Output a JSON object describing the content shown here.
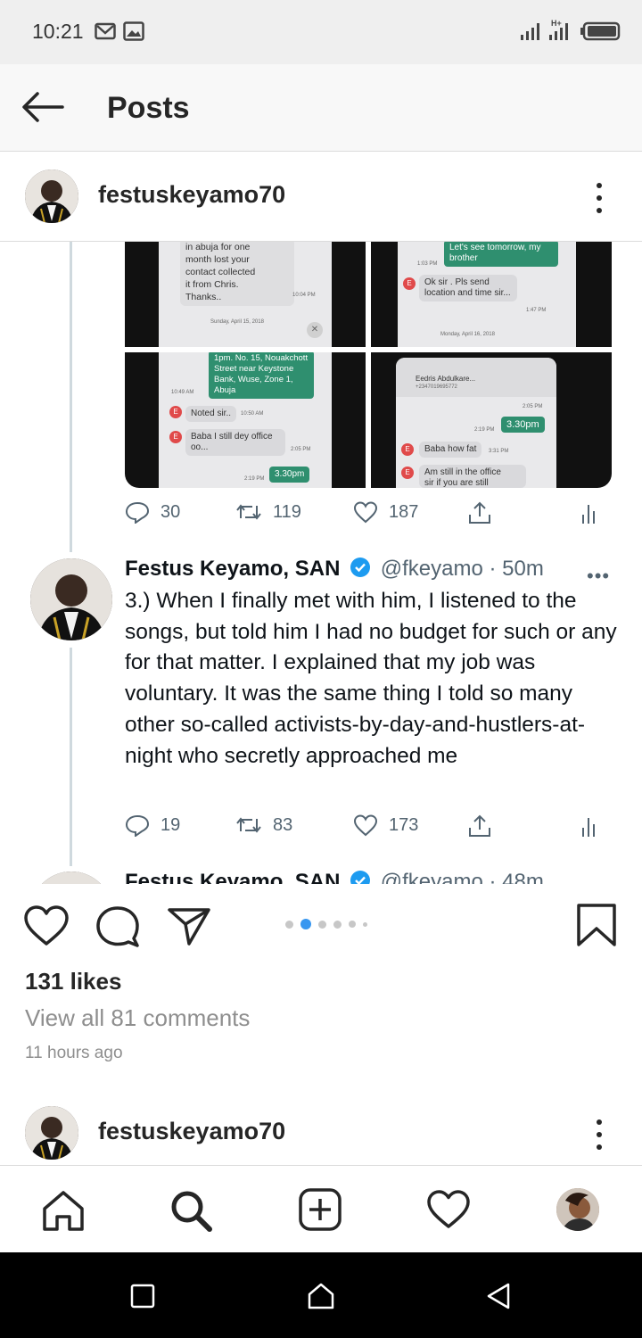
{
  "status_bar": {
    "time": "10:21",
    "icons": [
      "mail-icon",
      "image-icon",
      "signal-icon",
      "signal-h-plus-icon",
      "battery-icon"
    ]
  },
  "app_bar": {
    "title": "Posts",
    "back_icon": "arrow-left-icon"
  },
  "post": {
    "username": "festuskeyamo70",
    "carousel": {
      "total": 6,
      "current": 2
    },
    "screenshots": {
      "top_left": {
        "lines": [
          "in abuja for one",
          "month lost your",
          "contact collected",
          "it from Chris.",
          "Thanks.."
        ],
        "time": "10:04 PM",
        "date": "Sunday, April 15, 2018"
      },
      "top_right": {
        "green_bubble": "Let's see tomorrow, my brother",
        "green_time": "1:03 PM",
        "grey_bubble": "Ok sir . Pls send location and time sir...",
        "grey_time": "1:47 PM",
        "date": "Monday, April 16, 2018"
      },
      "bottom_left": {
        "green_bubble": "1pm. No. 15, Nouakchott Street near Keystone Bank, Wuse, Zone 1, Abuja",
        "green_time": "10:49 AM",
        "msg1": "Noted sir..",
        "msg1_time": "10:50 AM",
        "msg2": "Baba I still dey office oo...",
        "msg2_time": "2:05 PM",
        "green2": "3.30pm",
        "green2_time": "2:19 PM"
      },
      "bottom_right": {
        "contact": "Eedris Abdulkare...",
        "number": "+2347019695772",
        "time_top": "2:05 PM",
        "green": "3.30pm",
        "green_time": "2:19 PM",
        "msg1": "Baba how fat",
        "msg1_time": "3:31 PM",
        "msg2": "Am still in the office",
        "msg2_tail": "sir if you are still"
      }
    },
    "tweet_prev_stats": {
      "replies": "30",
      "retweets": "119",
      "likes": "187"
    },
    "tweet": {
      "name": "Festus Keyamo, SAN",
      "handle": "@fkeyamo",
      "sep": "·",
      "time": "50m",
      "text": "3.) When I finally met with him, I listened to the songs, but told him I had no budget for such or any for that matter. I explained that my job was voluntary. It was the same thing I told so many other so-called activists-by-day-and-hustlers-at-night who secretly approached me",
      "replies": "19",
      "retweets": "83",
      "likes": "173"
    },
    "tweet_next": {
      "name": "Festus Keyamo, SAN",
      "handle": "@fkeyamo",
      "sep": "·",
      "time": "48m"
    },
    "likes_text": "131 likes",
    "comments_text": "View all 81 comments",
    "time_ago": "11 hours ago"
  },
  "next_post": {
    "username": "festuskeyamo70"
  },
  "bottom_nav": [
    "home-icon",
    "search-icon",
    "add-post-icon",
    "activity-heart-icon",
    "profile-avatar"
  ],
  "system_nav": [
    "recent-apps-icon",
    "home-button-icon",
    "back-triangle-icon"
  ],
  "colors": {
    "verified": "#1d9bf0",
    "carousel_active": "#3897f0",
    "whatsapp_green": "#2f8f6f"
  }
}
